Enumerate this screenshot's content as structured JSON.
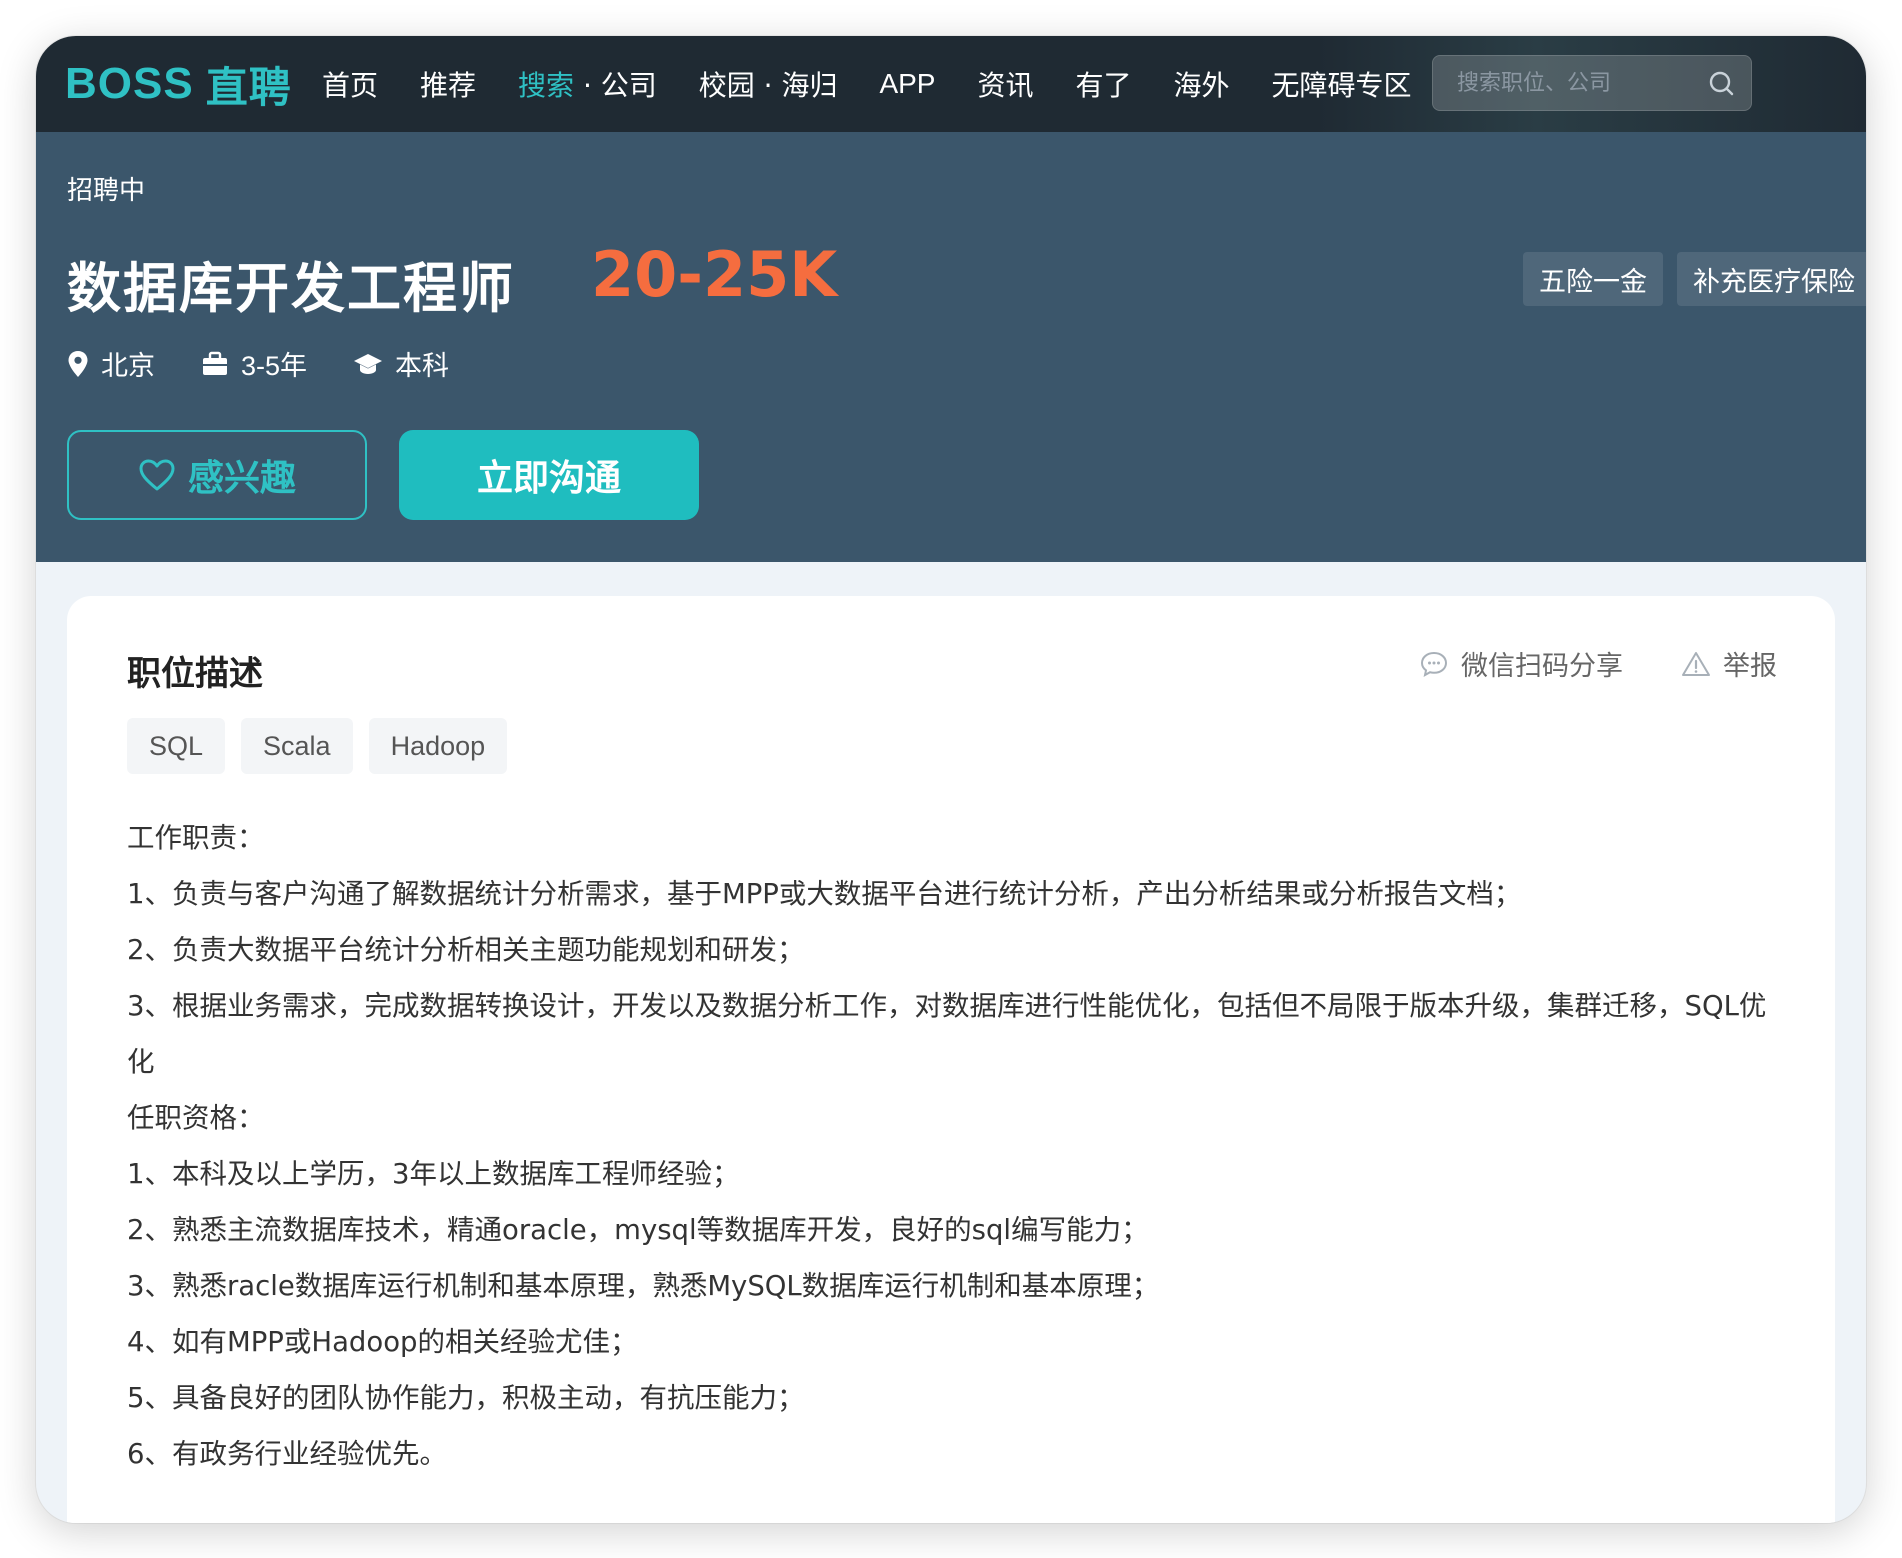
{
  "nav": {
    "logo_latin": "BOSS",
    "logo_cjk": "直聘",
    "items": [
      {
        "label": "首页"
      },
      {
        "label": "推荐"
      },
      {
        "label_active": "搜索",
        "label_rest": " · 公司"
      },
      {
        "label": "校园 · 海归"
      },
      {
        "label": "APP"
      },
      {
        "label": "资讯"
      },
      {
        "label": "有了"
      },
      {
        "label": "海外"
      },
      {
        "label": "无障碍专区"
      }
    ],
    "search_placeholder": "搜索职位、公司"
  },
  "job": {
    "status": "招聘中",
    "title": "数据库开发工程师",
    "salary": "20-25K",
    "benefits": [
      "五险一金",
      "补充医疗保险"
    ],
    "location": "北京",
    "experience": "3-5年",
    "education": "本科",
    "interest_label": "感兴趣",
    "chat_label": "立即沟通"
  },
  "description": {
    "title": "职位描述",
    "share_label": "微信扫码分享",
    "report_label": "举报",
    "skills": [
      "SQL",
      "Scala",
      "Hadoop"
    ],
    "lines": [
      "工作职责：",
      "1、负责与客户沟通了解数据统计分析需求，基于MPP或大数据平台进行统计分析，产出分析结果或分析报告文档；",
      "2、负责大数据平台统计分析相关主题功能规划和研发；",
      "3、根据业务需求，完成数据转换设计，开发以及数据分析工作，对数据库进行性能优化，包括但不局限于版本升级，集群迁移，SQL优化",
      "任职资格：",
      "1、本科及以上学历，3年以上数据库工程师经验；",
      "2、熟悉主流数据库技术，精通oracle，mysql等数据库开发，良好的sql编写能力；",
      "3、熟悉racle数据库运行机制和基本原理，熟悉MySQL数据库运行机制和基本原理；",
      "4、如有MPP或Hadoop的相关经验尤佳；",
      "5、具备良好的团队协作能力，积极主动，有抗压能力；",
      "6、有政务行业经验优先。"
    ]
  },
  "colors": {
    "brand": "#2fc1c4",
    "salary": "#f56d3f",
    "header_bg": "#3b566b",
    "nav_bg": "#1f2a33"
  }
}
